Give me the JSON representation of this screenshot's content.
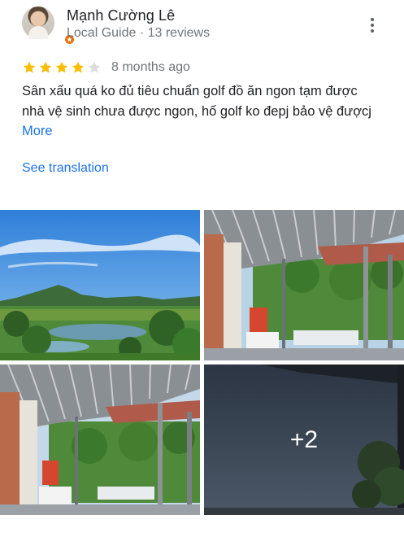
{
  "reviewer": {
    "name": "Mạnh Cường Lê",
    "meta": "Local Guide · 13 reviews",
    "avatar_icon": "user-avatar",
    "badge_icon": "local-guide-star-icon",
    "badge_color": "#e8710a"
  },
  "menu": {
    "icon": "more-vert-icon"
  },
  "review": {
    "rating": 4,
    "rating_max": 5,
    "star_color": "#fbbc04",
    "empty_star_color": "#dadce0",
    "date": "8 months ago",
    "text": "Sân xấu quá ko đủ tiêu chuẩn golf đồ ăn ngon tạm được nhà vệ sinh chưa được ngon, hố golf ko đepj bảo vệ đượcj",
    "more_label": "More",
    "translation_label": "See translation"
  },
  "photos": {
    "extra_count_label": "+2",
    "items": [
      {
        "icon": "photo-golf-course-landscape"
      },
      {
        "icon": "photo-covered-veranda"
      },
      {
        "icon": "photo-covered-veranda-2"
      },
      {
        "icon": "photo-dark-more"
      }
    ]
  },
  "colors": {
    "link": "#1a73e8",
    "secondary_text": "#70757a"
  }
}
